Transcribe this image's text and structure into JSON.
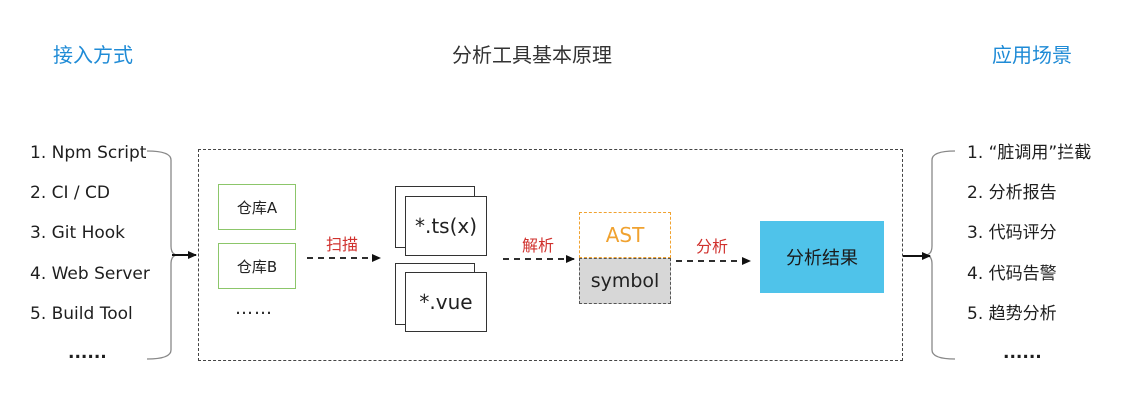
{
  "headers": {
    "access": "接入方式",
    "principle": "分析工具基本原理",
    "scenarios": "应用场景"
  },
  "access_methods": [
    "1. Npm Script",
    "2. CI / CD",
    "3. Git Hook",
    "4. Web Server",
    "5. Build Tool",
    "......"
  ],
  "scenarios": [
    "1. “脏调用”拦截",
    "2. 分析报告",
    "3. 代码评分",
    "4. 代码告警",
    "5. 趋势分析",
    "......"
  ],
  "repos": [
    "仓库A",
    "仓库B",
    "……"
  ],
  "files": [
    "*.ts(x)",
    "*.vue"
  ],
  "edges": {
    "scan": "扫描",
    "parse": "解析",
    "analyze": "分析"
  },
  "ast_label": "AST",
  "symbol_label": "symbol",
  "result_label": "分析结果",
  "colors": {
    "header_blue": "#1f8bd6",
    "repo_border": "#8cc66a",
    "ast_orange": "#f0a230",
    "edge_red": "#d0312d",
    "result_blue": "#4fc3ea",
    "symbol_gray": "#d7d7d7"
  }
}
